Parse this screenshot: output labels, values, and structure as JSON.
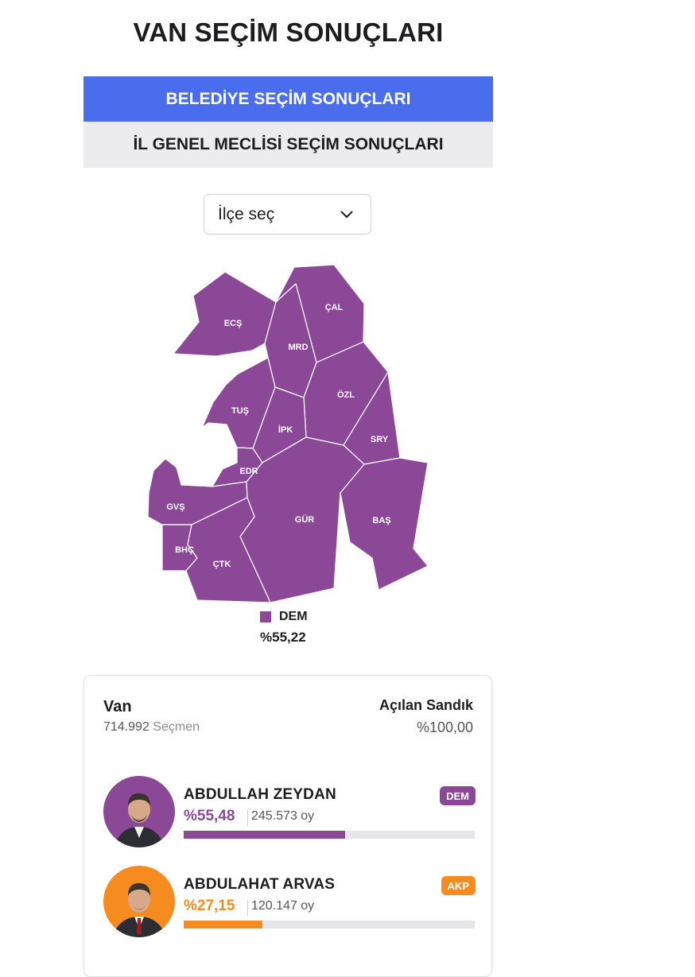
{
  "page": {
    "title": "VAN SEÇİM SONUÇLARI"
  },
  "tabs": [
    {
      "label": "BELEDİYE SEÇİM SONUÇLARI",
      "active": true
    },
    {
      "label": "İL GENEL MECLİSİ SEÇİM SONUÇLARI",
      "active": false
    }
  ],
  "district_select": {
    "value": "İlçe seç"
  },
  "map": {
    "fill_color": "#8a4897",
    "districts": [
      {
        "code": "ECŞ"
      },
      {
        "code": "ÇAL"
      },
      {
        "code": "MRD"
      },
      {
        "code": "ÖZL"
      },
      {
        "code": "TUŞ"
      },
      {
        "code": "İPK"
      },
      {
        "code": "SRY"
      },
      {
        "code": "EDR"
      },
      {
        "code": "GVŞ"
      },
      {
        "code": "GÜR"
      },
      {
        "code": "BAŞ"
      },
      {
        "code": "BHÇ"
      },
      {
        "code": "ÇTK"
      }
    ],
    "legend": {
      "party": "DEM",
      "percent": "%55,22",
      "color": "#8a4897"
    }
  },
  "summary": {
    "region": "Van",
    "voters_count": "714.992",
    "voters_label": "Seçmen",
    "opened_label": "Açılan Sandık",
    "opened_value": "%100,00"
  },
  "candidates": [
    {
      "name": "ABDULLAH ZEYDAN",
      "party": "DEM",
      "percent": "%55,48",
      "votes": "245.573 oy",
      "share": 55.48,
      "color": "#8a4897"
    },
    {
      "name": "ABDULAHAT ARVAS",
      "party": "AKP",
      "percent": "%27,15",
      "votes": "120.147 oy",
      "share": 27.15,
      "color": "#f68b1f"
    }
  ]
}
